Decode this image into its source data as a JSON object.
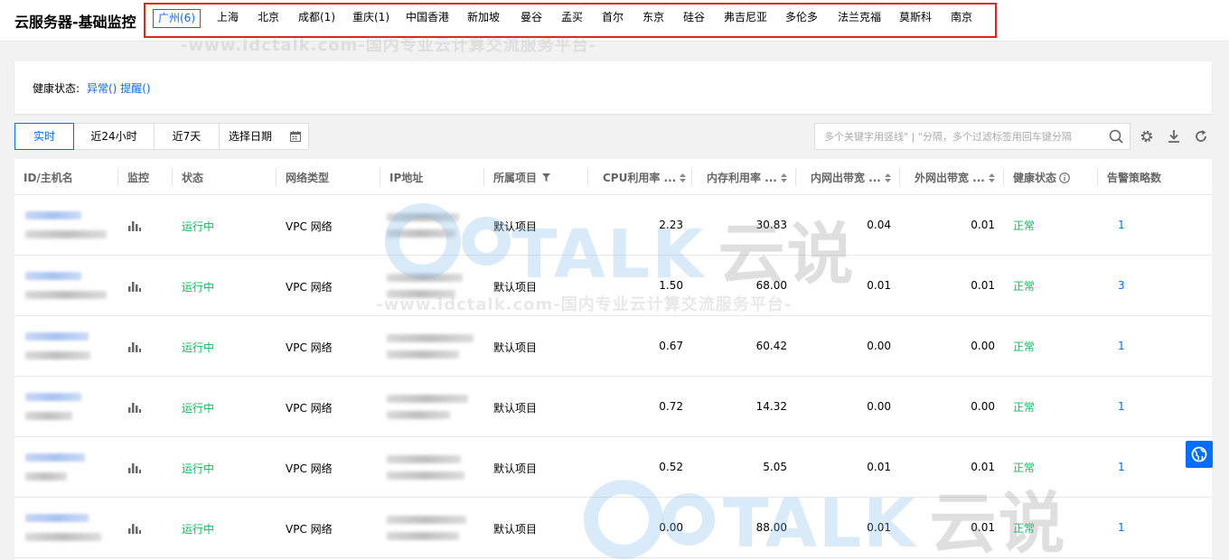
{
  "header": {
    "title": "云服务器-基础监控",
    "regions": [
      "广州(6)",
      "上海",
      "北京",
      "成都(1)",
      "重庆(1)",
      "中国香港",
      "新加坡",
      "曼谷",
      "孟买",
      "首尔",
      "东京",
      "硅谷",
      "弗吉尼亚",
      "多伦多",
      "法兰克福",
      "莫斯科",
      "南京"
    ],
    "active_region": "广州(6)"
  },
  "health": {
    "label": "健康状态:",
    "abnormal": "异常()",
    "remind": "提醒()"
  },
  "toolbar": {
    "time_ranges": [
      "实时",
      "近24小时",
      "近7天"
    ],
    "date_picker": "选择日期",
    "search_placeholder": "多个关键字用竖线\" | \"分隔，多个过滤标签用回车键分隔"
  },
  "table": {
    "columns": [
      "ID/主机名",
      "监控",
      "状态",
      "网络类型",
      "IP地址",
      "所属项目",
      "CPU利用率 ...",
      "内存利用率 ...",
      "内网出带宽 ...",
      "外网出带宽 ...",
      "健康状态",
      "告警策略数"
    ],
    "rows": [
      {
        "status": "运行中",
        "network": "VPC 网络",
        "project": "默认项目",
        "cpu": "2.23",
        "mem": "30.83",
        "lan_out": "0.04",
        "wan_out": "0.01",
        "health": "正常",
        "policies": "1"
      },
      {
        "status": "运行中",
        "network": "VPC 网络",
        "project": "默认项目",
        "cpu": "1.50",
        "mem": "68.00",
        "lan_out": "0.01",
        "wan_out": "0.01",
        "health": "正常",
        "policies": "3"
      },
      {
        "status": "运行中",
        "network": "VPC 网络",
        "project": "默认项目",
        "cpu": "0.67",
        "mem": "60.42",
        "lan_out": "0.00",
        "wan_out": "0.00",
        "health": "正常",
        "policies": "1"
      },
      {
        "status": "运行中",
        "network": "VPC 网络",
        "project": "默认项目",
        "cpu": "0.72",
        "mem": "14.32",
        "lan_out": "0.00",
        "wan_out": "0.00",
        "health": "正常",
        "policies": "1"
      },
      {
        "status": "运行中",
        "network": "VPC 网络",
        "project": "默认项目",
        "cpu": "0.52",
        "mem": "5.05",
        "lan_out": "0.01",
        "wan_out": "0.01",
        "health": "正常",
        "policies": "1"
      },
      {
        "status": "运行中",
        "network": "VPC 网络",
        "project": "默认项目",
        "cpu": "0.00",
        "mem": "88.00",
        "lan_out": "0.01",
        "wan_out": "0.01",
        "health": "正常",
        "policies": "1"
      }
    ]
  },
  "watermark": {
    "url": "-www.idctalk.com-国内专业云计算交流服务平台-",
    "logo_latin": "TALK",
    "logo_cjk": "云说"
  },
  "colors": {
    "accent": "#006eff",
    "success": "#0abf5b",
    "highlight_border": "#e1251b"
  }
}
